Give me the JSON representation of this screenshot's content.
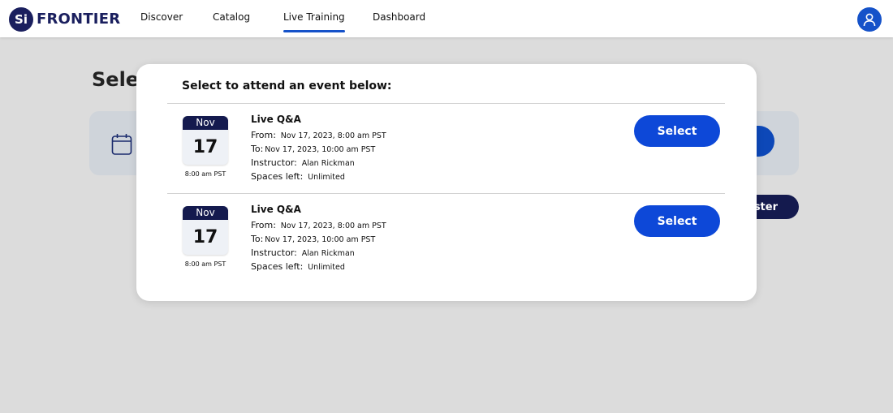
{
  "header": {
    "logo_badge": "Si",
    "logo_text": "FRONTIER",
    "nav": [
      {
        "label": "Discover"
      },
      {
        "label": "Catalog"
      },
      {
        "label": "Live Training"
      },
      {
        "label": "Dashboard"
      }
    ],
    "active_nav": "Live Training",
    "avatar_icon": "user-icon"
  },
  "background": {
    "title_partial": "Selec",
    "register_partial": "ster",
    "calendar_icon": "calendar-icon"
  },
  "modal": {
    "title": "Select to attend an event below:",
    "events": [
      {
        "month": "Nov",
        "day": "17",
        "time": "8:00 am PST",
        "name": "Live Q&A",
        "from_label": "From:",
        "from_value": "Nov 17, 2023, 8:00 am PST",
        "to_label": "To:",
        "to_value": "Nov 17, 2023, 10:00 am PST",
        "instructor_label": "Instructor:",
        "instructor_value": "Alan Rickman",
        "spaces_label": "Spaces left:",
        "spaces_value": "Unlimited",
        "button_label": "Select"
      },
      {
        "month": "Nov",
        "day": "17",
        "time": "8:00 am PST",
        "name": "Live Q&A",
        "from_label": "From:",
        "from_value": "Nov 17, 2023, 8:00 am PST",
        "to_label": "To:",
        "to_value": "Nov 17, 2023, 10:00 am PST",
        "instructor_label": "Instructor:",
        "instructor_value": "Alan Rickman",
        "spaces_label": "Spaces left:",
        "spaces_value": "Unlimited",
        "button_label": "Select"
      }
    ]
  },
  "colors": {
    "brand_navy": "#1a1f5e",
    "accent_blue": "#0d48d8",
    "overlay_gray": "#dcdcdc"
  }
}
